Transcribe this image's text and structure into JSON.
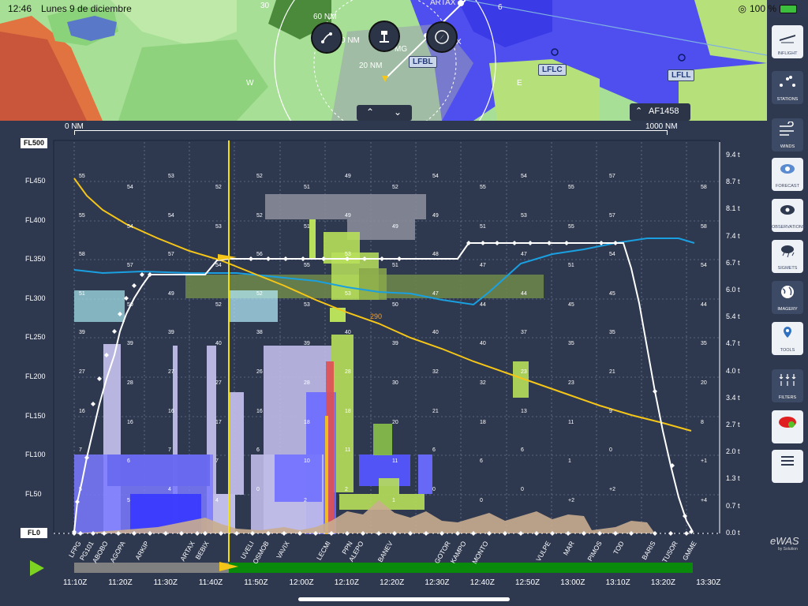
{
  "status_bar": {
    "time": "12:46",
    "date": "Lunes 9 de diciembre",
    "battery": "100 %"
  },
  "map": {
    "labels": {
      "artax": "ARTAX",
      "nm60": "60 NM",
      "nm20": "20 NM",
      "nm_partial": "0 NM",
      "mg": "MG",
      "x": "X",
      "num30": "30",
      "num6": "6",
      "w": "W",
      "e": "E"
    },
    "airports": [
      "LFBL",
      "LFLC",
      "LFLL"
    ],
    "flight": "AF1458"
  },
  "chart": {
    "range_start": "0 NM",
    "range_end": "1000 NM",
    "fl_top_badge": "FL500",
    "fl_bottom_badge": "FL0",
    "fl_labels": [
      "FL450",
      "FL400",
      "FL350",
      "FL300",
      "FL250",
      "FL200",
      "FL150",
      "FL100",
      "FL50"
    ],
    "weight_labels": [
      "9.4 t",
      "8.7 t",
      "8.1 t",
      "7.4 t",
      "6.7 t",
      "6.0 t",
      "5.4 t",
      "4.7 t",
      "4.0 t",
      "3.4 t",
      "2.7 t",
      "2.0 t",
      "1.3 t",
      "0.7 t",
      "0.0 t"
    ],
    "marker_290": "290",
    "waypoints": [
      "LFPG",
      "PG101",
      "ABOBO",
      "AGOPA",
      "ARKIP",
      "ARTAX",
      "BEBIX",
      "UVELI",
      "OSMOB",
      "VAVIX",
      "LECMI",
      "PPN",
      "ALEPO",
      "BANEV",
      "GOTOR",
      "KAMPO",
      "MONTO",
      "VULPE",
      "MAR",
      "PIMOS",
      "TOD",
      "BARIS",
      "TUSOR",
      "GMME"
    ],
    "times": [
      "11:10Z",
      "11:20Z",
      "11:30Z",
      "11:40Z",
      "11:50Z",
      "12:00Z",
      "12:10Z",
      "12:20Z",
      "12:30Z",
      "12:40Z",
      "12:50Z",
      "13:00Z",
      "13:10Z",
      "13:20Z",
      "13:30Z"
    ],
    "temps": {
      "fl450": [
        "55",
        "54",
        "53",
        "52",
        "52",
        "51",
        "49",
        "52",
        "54",
        "55",
        "54",
        "55",
        "57",
        "58"
      ],
      "fl400": [
        "55",
        "54",
        "54",
        "53",
        "52",
        "51",
        "49",
        "49",
        "49",
        "51",
        "53",
        "55",
        "57",
        "58"
      ],
      "fl350": [
        "58",
        "57",
        "57",
        "54",
        "56",
        "55",
        "53",
        "51",
        "48",
        "47",
        "47",
        "51",
        "54",
        "54"
      ],
      "fl300": [
        "51",
        "50",
        "49",
        "52",
        "52",
        "53",
        "53",
        "50",
        "47",
        "44",
        "44",
        "45",
        "45",
        "44"
      ],
      "fl250": [
        "39",
        "39",
        "39",
        "40",
        "38",
        "39",
        "40",
        "39",
        "40",
        "40",
        "37",
        "35",
        "35",
        "35"
      ],
      "fl200": [
        "27",
        "28",
        "27",
        "27",
        "26",
        "28",
        "28",
        "30",
        "32",
        "32",
        "23",
        "23",
        "21",
        "20"
      ],
      "fl150": [
        "16",
        "16",
        "16",
        "17",
        "16",
        "18",
        "18",
        "20",
        "21",
        "18",
        "13",
        "11",
        "9",
        "8"
      ],
      "fl100": [
        "7",
        "6",
        "7",
        "7",
        "6",
        "10",
        "11",
        "11",
        "6",
        "6",
        "6",
        "1",
        "0",
        "+1"
      ],
      "fl50": [
        "5",
        "5",
        "4",
        "4",
        "0",
        "2",
        "2",
        "1",
        "0",
        "0",
        "0",
        "+2",
        "+2",
        "+4"
      ]
    }
  },
  "sidebar": {
    "items": [
      "INFLIGHT",
      "STATIONS",
      "WINDS",
      "FORECAST",
      "OBSERVATIONS",
      "SIGMETS",
      "IMAGERY",
      "TOOLS",
      "FILTERS"
    ],
    "logo": "eWAS",
    "logo_sub": "by Solution"
  },
  "colors": {
    "accent": "#f5c518",
    "route": "#ffffff",
    "temp_line": "#1aa0e0",
    "weight_line": "#f5c518",
    "progress_done": "#808080",
    "progress_todo": "#0a8a0a"
  }
}
